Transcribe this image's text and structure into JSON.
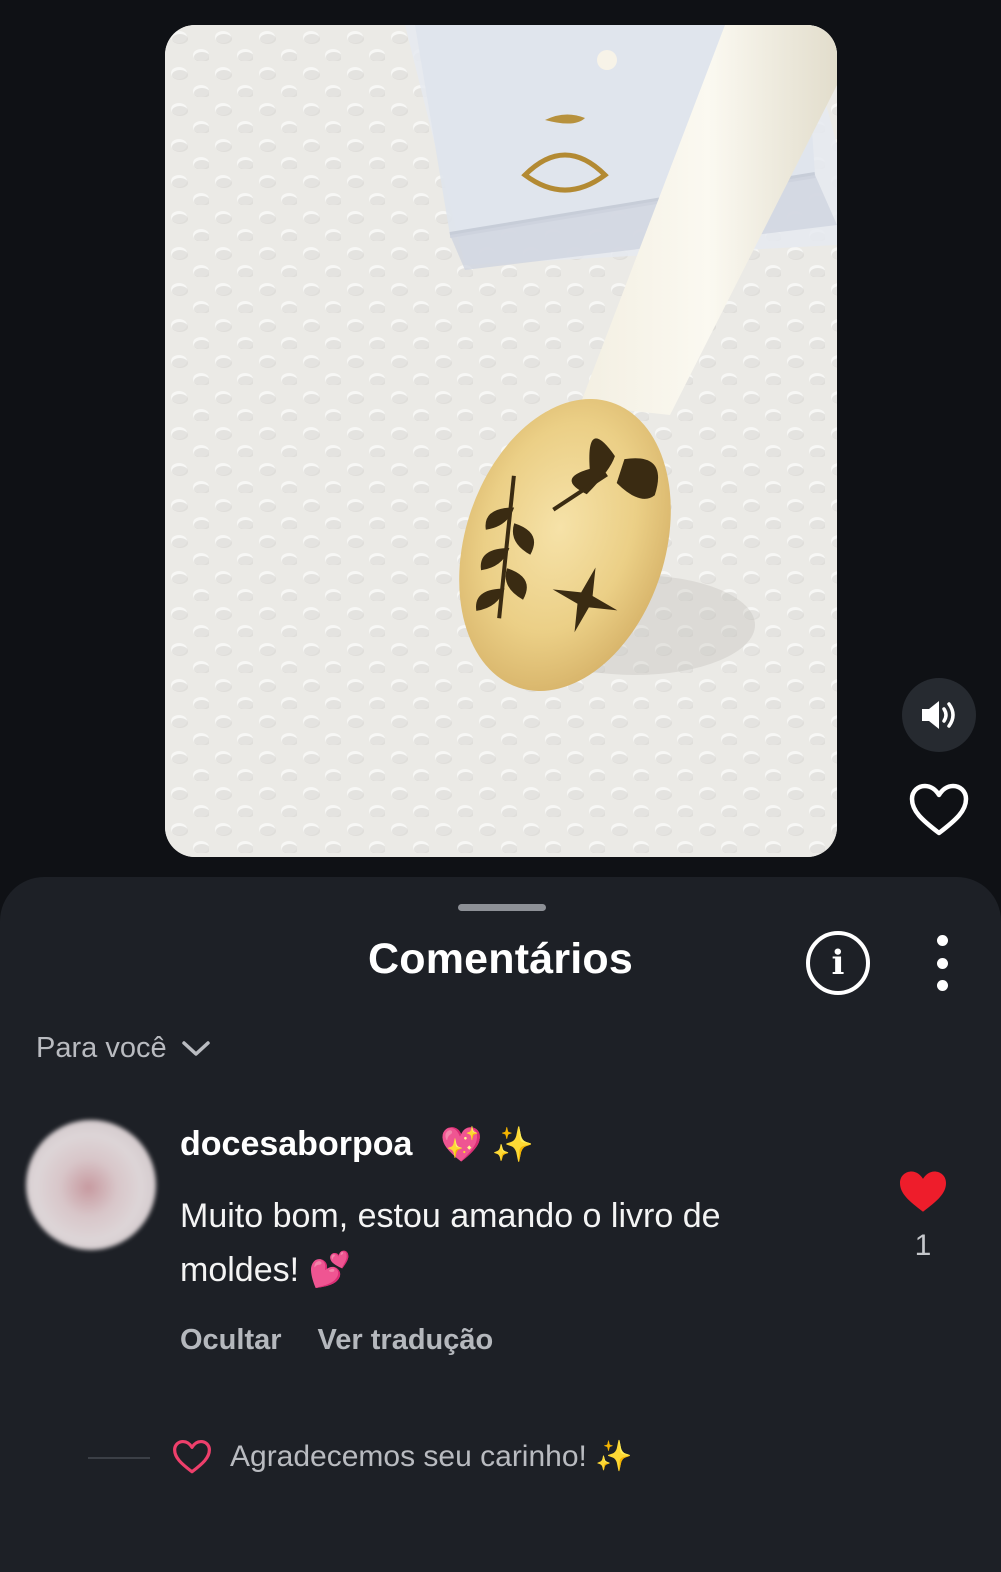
{
  "video": {
    "sound_icon": "speaker-volume-icon",
    "like_icon": "heart-outline-icon"
  },
  "comments_sheet": {
    "title": "Comentários",
    "info_icon_glyph": "i",
    "sort_label": "Para você",
    "comment": {
      "username": "docesaborpoa",
      "badges": "💖 ✨",
      "text": "Muito bom, estou amando o livro de moldes! 💕",
      "hide_label": "Ocultar",
      "translate_label": "Ver tradução",
      "like_count": "1"
    },
    "reply": {
      "text": "Agradecemos seu carinho! ✨"
    }
  },
  "colors": {
    "background": "#0f1115",
    "sheet": "#1d2026",
    "like_red": "#ee1d2b",
    "reply_heart": "#ee3f6b"
  }
}
